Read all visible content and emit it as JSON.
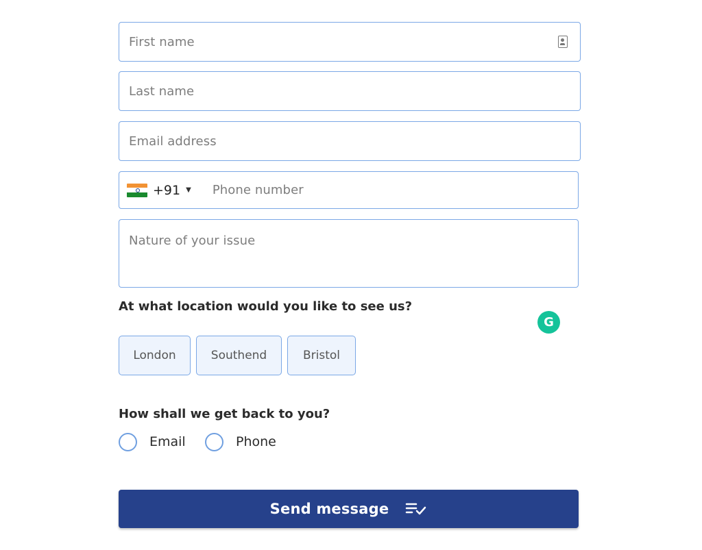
{
  "form": {
    "first_name_placeholder": "First name",
    "last_name_placeholder": "Last name",
    "email_placeholder": "Email address",
    "phone": {
      "country_code": "+91",
      "placeholder": "Phone number",
      "flag": "india-flag-icon"
    },
    "issue_placeholder": "Nature of your issue"
  },
  "location": {
    "question": "At what location would you like to see us?",
    "options": [
      "London",
      "Southend",
      "Bristol"
    ]
  },
  "contact": {
    "question": "How shall we get back to you?",
    "options": [
      "Email",
      "Phone"
    ]
  },
  "submit": {
    "label": "Send message",
    "icon": "list-check-icon"
  },
  "extension": {
    "grammarly_letter": "G"
  },
  "colors": {
    "primary": "#26418b",
    "field_border": "#7aa7e6",
    "option_bg": "#eef4fd",
    "grammarly": "#15c39a"
  }
}
